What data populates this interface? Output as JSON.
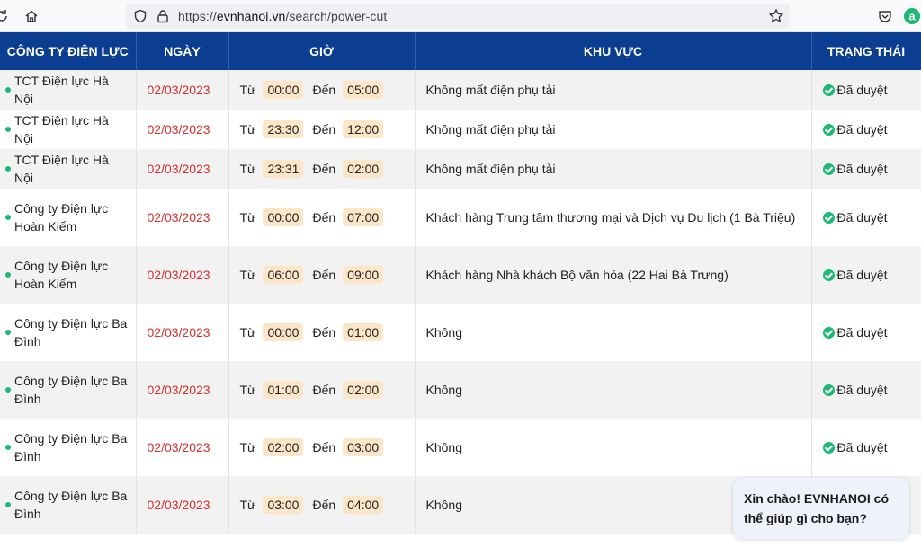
{
  "browser": {
    "url_prefix": "https://",
    "url_host": "evnhanoi.vn",
    "url_path": "/search/power-cut"
  },
  "table": {
    "headers": [
      "CÔNG TY ĐIỆN LỰC",
      "NGÀY",
      "GIỜ",
      "KHU VỰC",
      "TRẠNG THÁI"
    ],
    "from_label": "Từ",
    "to_label": "Đến",
    "rows": [
      {
        "company": "TCT Điện lực Hà Nội",
        "date": "02/03/2023",
        "from": "00:00",
        "to": "05:00",
        "area": "Không mất điện phụ tải",
        "status": "Đã duyệt"
      },
      {
        "company": "TCT Điện lực Hà Nội",
        "date": "02/03/2023",
        "from": "23:30",
        "to": "12:00",
        "area": "Không mất điện phụ tải",
        "status": "Đã duyệt"
      },
      {
        "company": "TCT Điện lực Hà Nội",
        "date": "02/03/2023",
        "from": "23:31",
        "to": "02:00",
        "area": "Không mất điện phụ tải",
        "status": "Đã duyệt"
      },
      {
        "company": "Công ty Điện lực Hoàn Kiếm",
        "date": "02/03/2023",
        "from": "00:00",
        "to": "07:00",
        "area": "Khách hàng Trung tâm thương mại và Dịch vụ Du lịch (1 Bà Triệu)",
        "status": "Đã duyệt"
      },
      {
        "company": "Công ty Điện lực Hoàn Kiếm",
        "date": "02/03/2023",
        "from": "06:00",
        "to": "09:00",
        "area": "Khách hàng Nhà khách Bộ văn hóa (22 Hai Bà Trưng)",
        "status": "Đã duyệt"
      },
      {
        "company": "Công ty Điện lực Ba Đình",
        "date": "02/03/2023",
        "from": "00:00",
        "to": "01:00",
        "area": "Không",
        "status": "Đã duyệt"
      },
      {
        "company": "Công ty Điện lực Ba Đình",
        "date": "02/03/2023",
        "from": "01:00",
        "to": "02:00",
        "area": "Không",
        "status": "Đã duyệt"
      },
      {
        "company": "Công ty Điện lực Ba Đình",
        "date": "02/03/2023",
        "from": "02:00",
        "to": "03:00",
        "area": "Không",
        "status": "Đã duyệt"
      },
      {
        "company": "Công ty Điện lực Ba Đình",
        "date": "02/03/2023",
        "from": "03:00",
        "to": "04:00",
        "area": "Không",
        "status": ""
      }
    ]
  },
  "chat": {
    "greeting": "Xin chào! EVNHANOI có thể giúp gì cho bạn?"
  },
  "colors": {
    "header_bg": "#0b3d91",
    "date_red": "#d32f2f",
    "status_green": "#1db874",
    "time_pill": "#fbe6c8"
  }
}
